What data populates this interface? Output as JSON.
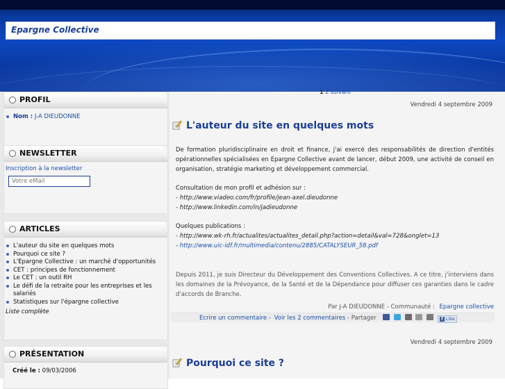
{
  "header": {
    "site_title": "Epargne Collective"
  },
  "sidebar": {
    "profil": {
      "title": "PROFIL",
      "name_label": "Nom :",
      "name_value": "J-A DIEUDONNE"
    },
    "newsletter": {
      "title": "NEWSLETTER",
      "subscribe_link": "Inscription à la newsletter",
      "email_placeholder": "Votre eMail"
    },
    "articles": {
      "title": "ARTICLES",
      "items": [
        "L'auteur du site en quelques mots",
        "Pourquoi ce site ?",
        "L'Epargne Collective : un marché d'opportunités",
        "CET : principes de fonctionnement",
        "Le CET : un outil RH",
        "Le défi de la retraite pour les entreprises et les salariés",
        "Statistiques sur l'épargne collective"
      ],
      "full_list_link": "Liste complète"
    },
    "presentation": {
      "title": "PRÉSENTATION",
      "created_label": "Créé le :",
      "created_value": "09/03/2006"
    }
  },
  "main": {
    "pager": {
      "current": "1",
      "next_page": "2",
      "next_label": "suivant"
    },
    "posts": [
      {
        "date": "Vendredi 4 septembre 2009",
        "title": "L'auteur du site en quelques mots",
        "intro": "De formation pluridisciplinaire en droit et finance, j'ai exercé des responsabilités de direction d'entités opérationnelles spécialisées en Epargne Collective avant de lancer, début 2009, une activité de conseil en organisation, stratégie marketing et développement commercial.",
        "consult_heading": "Consultation de mon profil et adhésion sur :",
        "consult_links": [
          " - http://www.viadeo.com/fr/profile/jean-axel.dieudonne",
          "- http://www.linkedin.com/in/jadieudonne"
        ],
        "pubs_heading": "Quelques publications :",
        "pub_link_1": "- http://www.wk-rh.fr/actualites/actualites_detail.php?action=detail&val=728&onglet=13",
        "pub_link_2_prefix": "- ",
        "pub_link_2": "http://www.uic-idf.fr/multimedia/contenu/2885/CATALYSEUR_58.pdf",
        "since_2011": "Depuis 2011, je suis Directeur du Développement des Conventions Collectives. A ce titre, j'interviens dans les domaines de la Prévoyance, de la Santé et de la Dépendance pour diffuser ces garanties dans le cadre d'accords de Branche.",
        "byline_prefix": "Par J-A DIEUDONNE - Communauté :",
        "community_link": "Epargne collective",
        "write_comment": "Ecrire un commentaire",
        "sep1": " - ",
        "view_comments": "Voir les 2 commentaires",
        "share_label": " - Partager",
        "like_label": "Like"
      },
      {
        "date": "Vendredi 4 septembre 2009",
        "title": "Pourquoi ce site ?"
      }
    ]
  },
  "colors": {
    "accent_blue": "#1b3f94",
    "link_blue": "#1a4fa8",
    "header_blue": "#0c47c0"
  }
}
